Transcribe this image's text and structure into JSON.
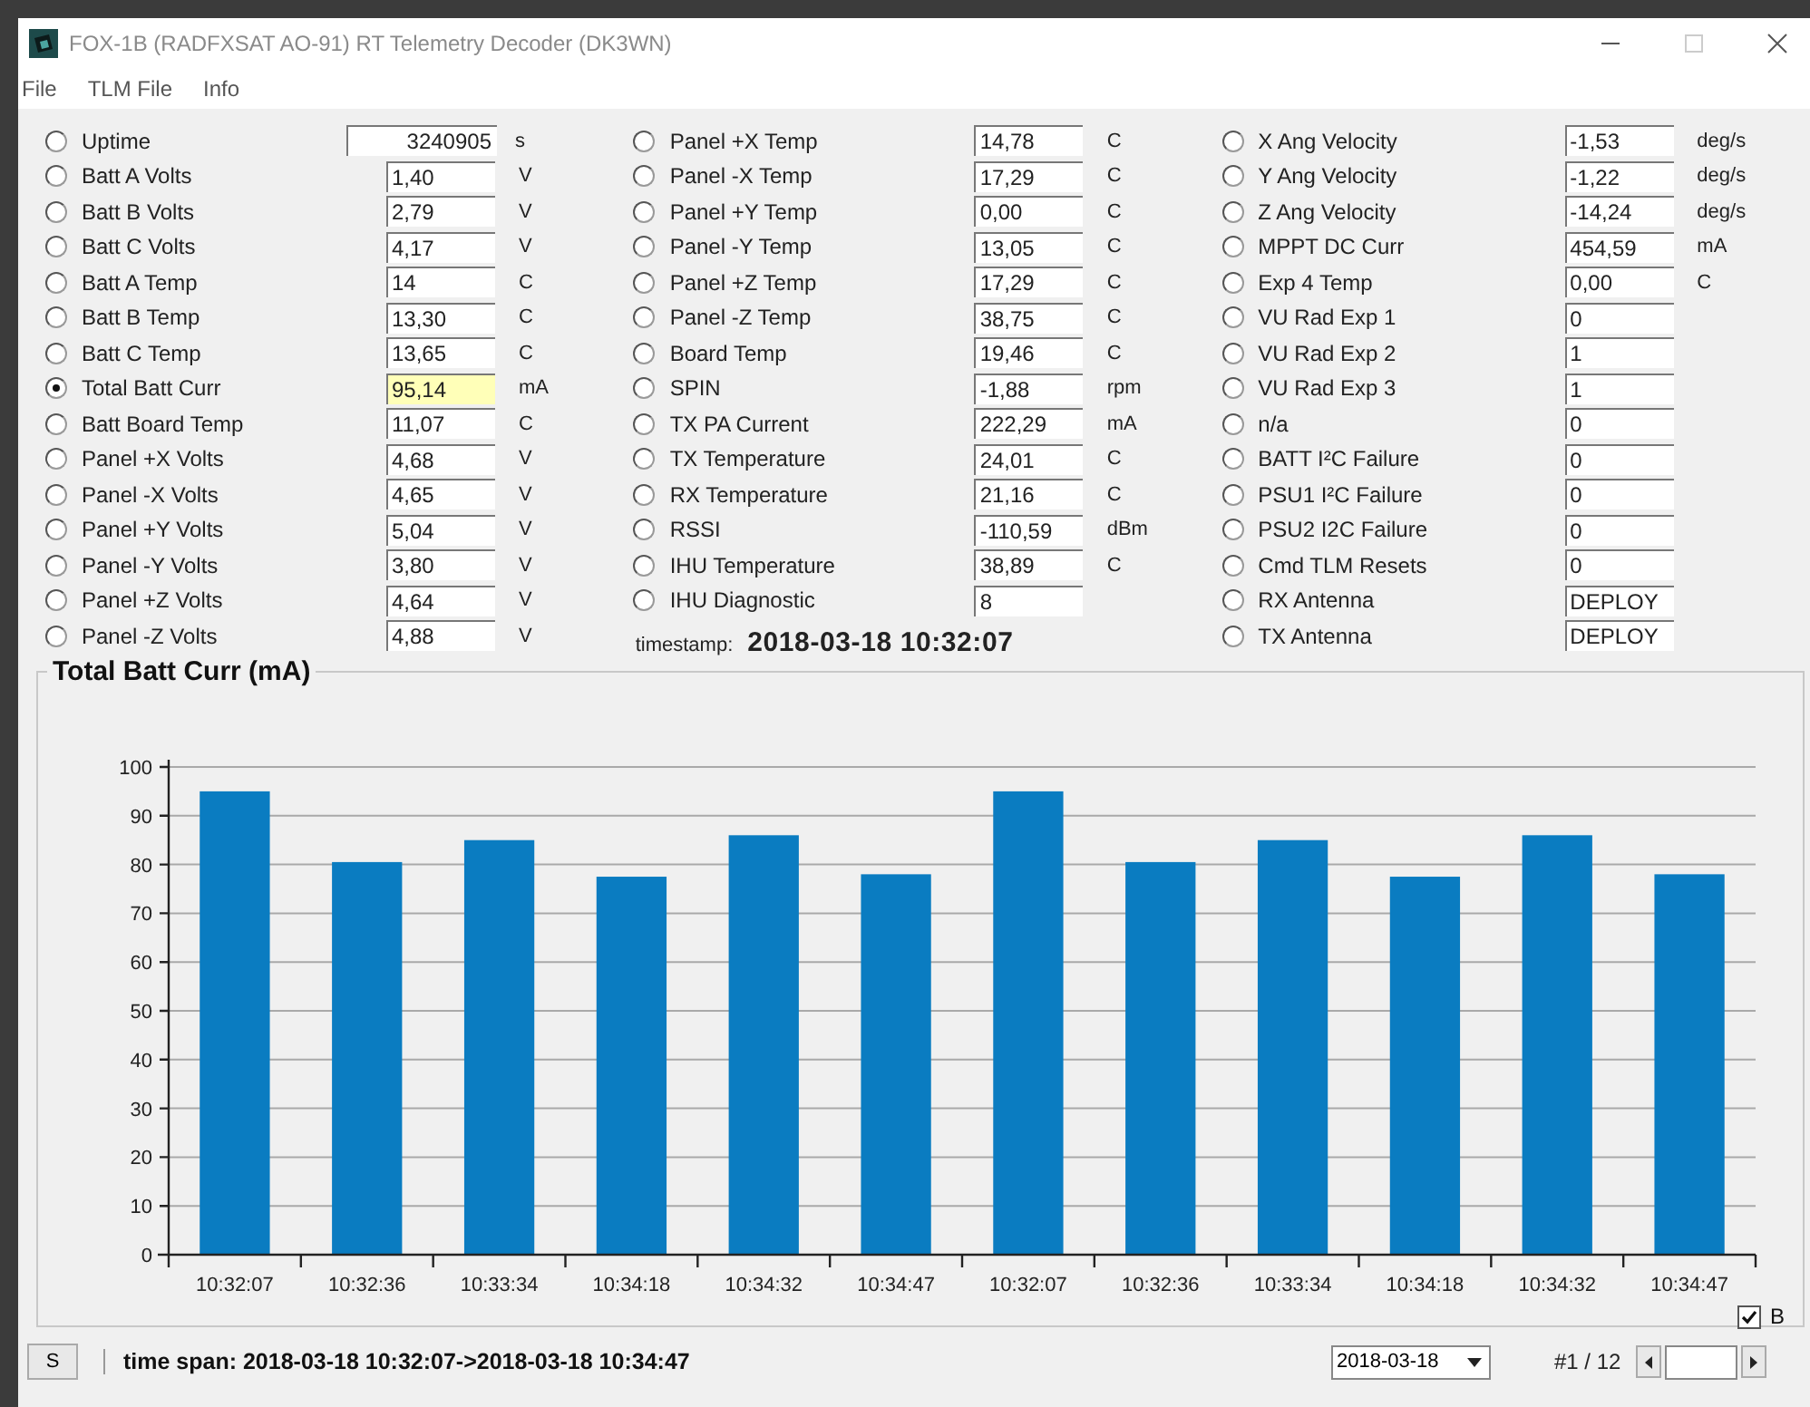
{
  "window": {
    "title": "FOX-1B (RADFXSAT AO-91) RT Telemetry Decoder  (DK3WN)"
  },
  "menu": [
    {
      "label": "File"
    },
    {
      "label": "TLM File"
    },
    {
      "label": "Info"
    }
  ],
  "columns": [
    {
      "rows": [
        {
          "label": "Uptime",
          "value": "3240905",
          "unit": "s",
          "selected": false
        },
        {
          "label": "Batt A Volts",
          "value": "1,40",
          "unit": "V",
          "selected": false
        },
        {
          "label": "Batt B Volts",
          "value": "2,79",
          "unit": "V",
          "selected": false
        },
        {
          "label": "Batt C Volts",
          "value": "4,17",
          "unit": "V",
          "selected": false
        },
        {
          "label": "Batt A Temp",
          "value": "14",
          "unit": "C",
          "selected": false
        },
        {
          "label": "Batt B Temp",
          "value": "13,30",
          "unit": "C",
          "selected": false
        },
        {
          "label": "Batt C Temp",
          "value": "13,65",
          "unit": "C",
          "selected": false
        },
        {
          "label": "Total Batt Curr",
          "value": "95,14",
          "unit": "mA",
          "selected": true
        },
        {
          "label": "Batt Board Temp",
          "value": "11,07",
          "unit": "C",
          "selected": false
        },
        {
          "label": "Panel +X Volts",
          "value": "4,68",
          "unit": "V",
          "selected": false
        },
        {
          "label": "Panel -X Volts",
          "value": "4,65",
          "unit": "V",
          "selected": false
        },
        {
          "label": "Panel +Y Volts",
          "value": "5,04",
          "unit": "V",
          "selected": false
        },
        {
          "label": "Panel -Y Volts",
          "value": "3,80",
          "unit": "V",
          "selected": false
        },
        {
          "label": "Panel +Z Volts",
          "value": "4,64",
          "unit": "V",
          "selected": false
        },
        {
          "label": "Panel -Z Volts",
          "value": "4,88",
          "unit": "V",
          "selected": false
        }
      ]
    },
    {
      "rows": [
        {
          "label": "Panel +X Temp",
          "value": "14,78",
          "unit": "C",
          "selected": false
        },
        {
          "label": "Panel -X Temp",
          "value": "17,29",
          "unit": "C",
          "selected": false
        },
        {
          "label": "Panel +Y Temp",
          "value": "0,00",
          "unit": "C",
          "selected": false
        },
        {
          "label": "Panel -Y Temp",
          "value": "13,05",
          "unit": "C",
          "selected": false
        },
        {
          "label": "Panel +Z Temp",
          "value": "17,29",
          "unit": "C",
          "selected": false
        },
        {
          "label": "Panel -Z Temp",
          "value": "38,75",
          "unit": "C",
          "selected": false
        },
        {
          "label": "Board Temp",
          "value": "19,46",
          "unit": "C",
          "selected": false
        },
        {
          "label": "SPIN",
          "value": "-1,88",
          "unit": "rpm",
          "selected": false
        },
        {
          "label": "TX PA Current",
          "value": "222,29",
          "unit": "mA",
          "selected": false
        },
        {
          "label": "TX Temperature",
          "value": "24,01",
          "unit": "C",
          "selected": false
        },
        {
          "label": "RX Temperature",
          "value": "21,16",
          "unit": "C",
          "selected": false
        },
        {
          "label": "RSSI",
          "value": "-110,59",
          "unit": "dBm",
          "selected": false
        },
        {
          "label": "IHU Temperature",
          "value": "38,89",
          "unit": "C",
          "selected": false
        },
        {
          "label": "IHU Diagnostic",
          "value": "8",
          "selected": false
        }
      ]
    },
    {
      "rows": [
        {
          "label": "X Ang Velocity",
          "value": "-1,53",
          "unit": "deg/s",
          "selected": false
        },
        {
          "label": "Y Ang Velocity",
          "value": "-1,22",
          "unit": "deg/s",
          "selected": false
        },
        {
          "label": "Z Ang Velocity",
          "value": "-14,24",
          "unit": "deg/s",
          "selected": false
        },
        {
          "label": "MPPT DC Curr",
          "value": "454,59",
          "unit": "mA",
          "selected": false
        },
        {
          "label": "Exp 4 Temp",
          "value": "0,00",
          "unit": "C",
          "selected": false
        },
        {
          "label": "VU Rad Exp 1",
          "value": "0",
          "selected": false
        },
        {
          "label": "VU Rad Exp 2",
          "value": "1",
          "selected": false
        },
        {
          "label": "VU Rad Exp 3",
          "value": "1",
          "selected": false
        },
        {
          "label": "n/a",
          "value": "0",
          "selected": false
        },
        {
          "label": "BATT I²C Failure",
          "value": "0",
          "selected": false
        },
        {
          "label": "PSU1 I²C Failure",
          "value": "0",
          "selected": false
        },
        {
          "label": "PSU2 I2C Failure",
          "value": "0",
          "selected": false
        },
        {
          "label": "Cmd TLM Resets",
          "value": "0",
          "selected": false
        },
        {
          "label": "RX Antenna",
          "value": "DEPLOY",
          "selected": false
        },
        {
          "label": "TX Antenna",
          "value": "DEPLOY",
          "selected": false
        }
      ]
    }
  ],
  "timestamp": {
    "label": "timestamp:",
    "value": "2018-03-18 10:32:07"
  },
  "chart": {
    "title": "Total Batt Curr (mA)",
    "chart_data": {
      "type": "bar",
      "categories": [
        "10:32:07",
        "10:32:36",
        "10:33:34",
        "10:34:18",
        "10:34:32",
        "10:34:47",
        "10:32:07",
        "10:32:36",
        "10:33:34",
        "10:34:18",
        "10:34:32",
        "10:34:47"
      ],
      "series": [
        {
          "color": "#0a7cc1",
          "values": [
            95,
            80.5,
            85,
            77.5,
            86,
            78,
            95,
            80.5,
            85,
            77.5,
            86,
            78
          ]
        }
      ],
      "ylim": [
        0,
        100
      ],
      "grid": true,
      "yticks": [
        0,
        10,
        20,
        30,
        40,
        50,
        60,
        70,
        80,
        90,
        100
      ]
    }
  },
  "checkbox": {
    "label": "B",
    "checked": true
  },
  "status_bar": {
    "button": "S",
    "time_span": "time span: 2018-03-18 10:32:07->2018-03-18 10:34:47",
    "date": "2018-03-18",
    "counter": "#1 / 12"
  }
}
